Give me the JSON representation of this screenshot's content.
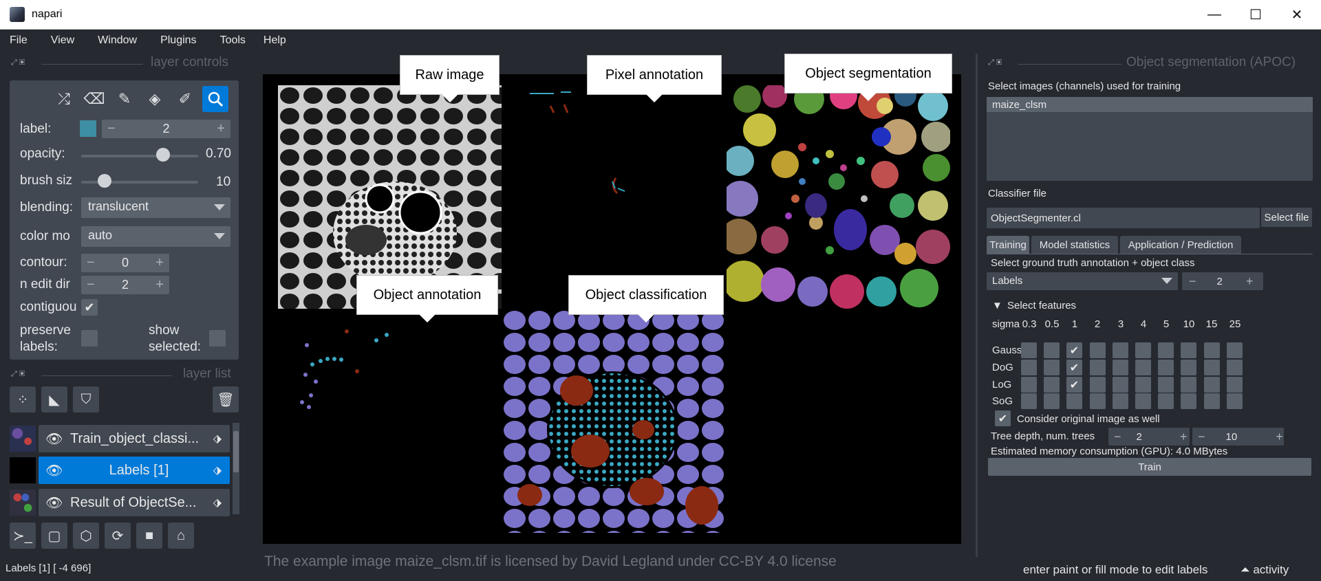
{
  "window": {
    "title": "napari",
    "minimize": "—",
    "maximize": "☐",
    "close": "✕"
  },
  "menu": [
    "File",
    "View",
    "Window",
    "Plugins",
    "Tools",
    "Help"
  ],
  "layer_controls": {
    "title": "layer controls",
    "label_label": "label:",
    "label_value": "2",
    "label_color": "#3e8fa4",
    "opacity_label": "opacity:",
    "opacity_value": "0.70",
    "opacity_fraction": 0.7,
    "brush_label": "brush siz",
    "brush_value": "10",
    "brush_fraction": 0.2,
    "blending_label": "blending:",
    "blending_value": "translucent",
    "colormode_label": "color mo",
    "colormode_value": "auto",
    "contour_label": "contour:",
    "contour_value": "0",
    "ndim_label": "n edit dir",
    "ndim_value": "2",
    "contiguous_label": "contiguou",
    "preserve_label": "preserve\nlabels:",
    "show_selected_label": "show\nselected:",
    "tools": [
      "shuffle-icon",
      "eraser-icon",
      "paint-brush-icon",
      "fill-bucket-icon",
      "color-picker-icon",
      "zoom-icon"
    ]
  },
  "layer_list": {
    "title": "layer list",
    "layers": [
      {
        "name": "Train_object_classi...",
        "selected": false
      },
      {
        "name": "Labels [1]",
        "selected": true
      },
      {
        "name": "Result of ObjectSe...",
        "selected": false
      }
    ]
  },
  "canvas": {
    "callouts": [
      "Raw image",
      "Pixel annotation",
      "Object segmentation",
      "Object annotation",
      "Object classification"
    ],
    "license": "The example image maize_clsm.tif is licensed by David Legland under CC-BY 4.0 license"
  },
  "apoc": {
    "title": "Object segmentation (APOC)",
    "select_images_label": "Select images (channels) used for training",
    "images": [
      "maize_clsm"
    ],
    "classifier_file_label": "Classifier file",
    "classifier_file_value": "ObjectSegmenter.cl",
    "select_file_button": "Select file",
    "tabs": [
      "Training",
      "Model statistics",
      "Application / Prediction"
    ],
    "ground_truth_label": "Select ground truth annotation + object class",
    "gt_layer": "Labels",
    "gt_class": "2",
    "select_features": "Select features",
    "sigma_label": "sigma",
    "sigmas": [
      "0.3",
      "0.5",
      "1",
      "2",
      "3",
      "4",
      "5",
      "10",
      "15",
      "25"
    ],
    "feature_rows": [
      "Gauss",
      "DoG",
      "LoG",
      "SoG"
    ],
    "checked": [
      [
        false,
        false,
        true,
        false,
        false,
        false,
        false,
        false,
        false,
        false
      ],
      [
        false,
        false,
        true,
        false,
        false,
        false,
        false,
        false,
        false,
        false
      ],
      [
        false,
        false,
        true,
        false,
        false,
        false,
        false,
        false,
        false,
        false
      ],
      [
        false,
        false,
        false,
        false,
        false,
        false,
        false,
        false,
        false,
        false
      ]
    ],
    "consider_original": "Consider original image as well",
    "tree_label": "Tree depth, num. trees",
    "tree_depth": "2",
    "num_trees": "10",
    "memory": "Estimated memory consumption (GPU): 4.0 MBytes",
    "train_button": "Train"
  },
  "status": {
    "left": "Labels [1] [ -4 696]",
    "right": "enter paint or fill mode to edit labels",
    "activity": "activity"
  }
}
